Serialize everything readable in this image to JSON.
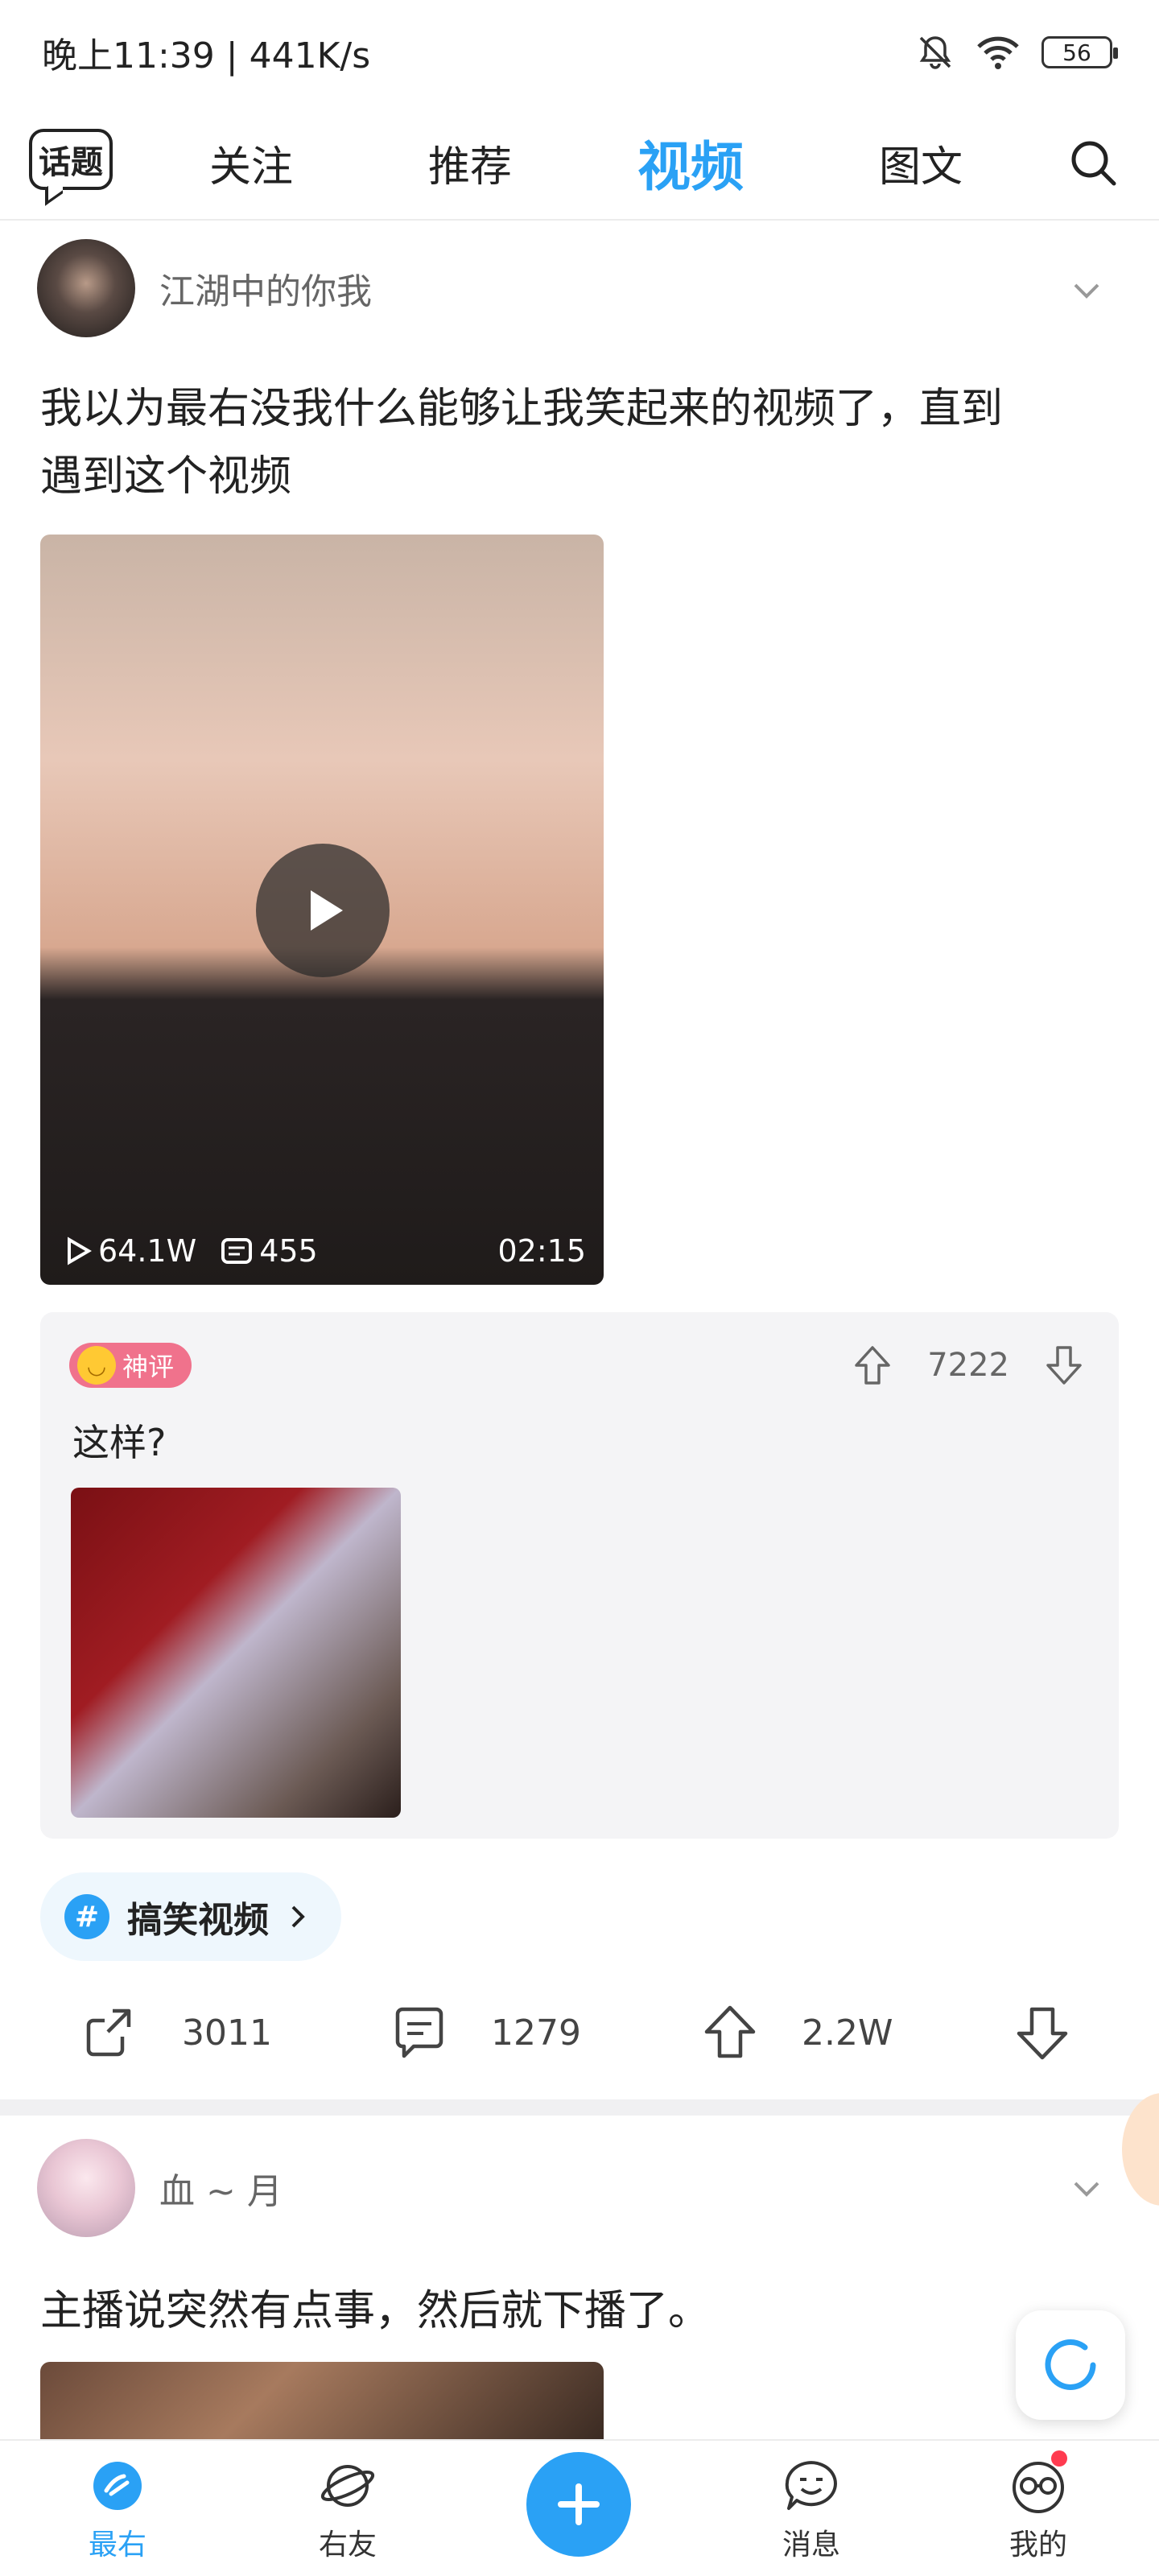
{
  "status_bar": {
    "time_speed": "晚上11:39 | 441K/s",
    "battery": "56"
  },
  "top_nav": {
    "topic_label": "话题",
    "tabs": [
      "关注",
      "推荐",
      "视频",
      "图文"
    ],
    "active_tab": "视频"
  },
  "post1": {
    "author": "江湖中的你我",
    "text_line1": "我以为最右没我什么能够让我笑起来的视频了，直到",
    "text_line2": "遇到这个视频",
    "video": {
      "plays": "64.1W",
      "danmaku": "455",
      "duration": "02:15"
    },
    "top_comment": {
      "badge": "神评",
      "upvotes": "7222",
      "text": "这样?"
    },
    "tag": "搞笑视频",
    "actions": {
      "share": "3011",
      "comments": "1279",
      "likes": "2.2W"
    }
  },
  "post2": {
    "author": "血 ~ 月",
    "text": "主播说突然有点事，然后就下播了。"
  },
  "bottom_nav": {
    "items": [
      "最右",
      "右友",
      "消息",
      "我的"
    ]
  },
  "colors": {
    "accent": "#2aa1f5",
    "badge": "#f0728c"
  }
}
